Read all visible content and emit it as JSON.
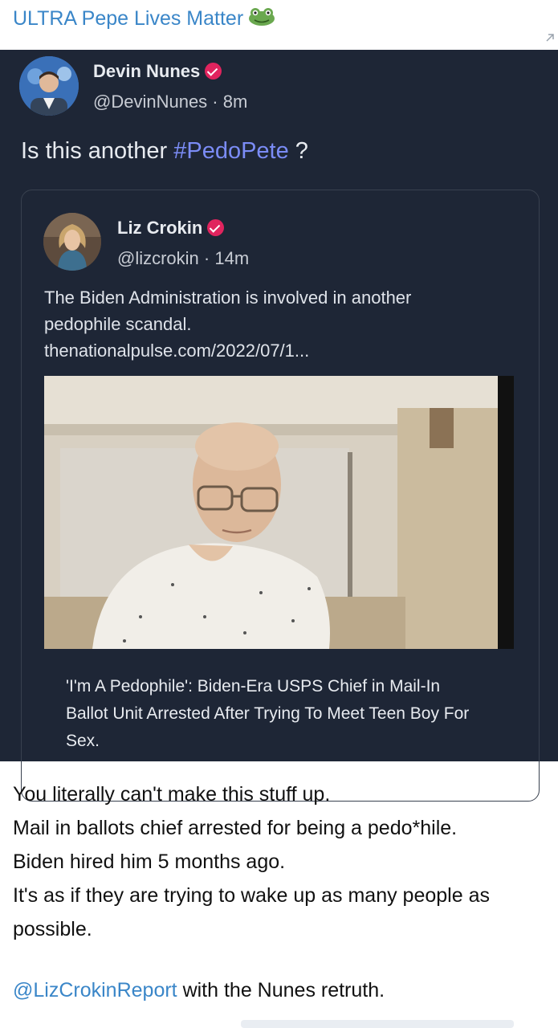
{
  "channel": {
    "title": "ULTRA Pepe Lives Matter"
  },
  "post": {
    "author_name": "Devin Nunes",
    "handle_time": "@DevinNunes · 8m",
    "text_before": "Is this another ",
    "hashtag": "#PedoPete",
    "text_after": " ?"
  },
  "quote": {
    "author_name": "Liz Crokin",
    "handle_time": "@lizcrokin · 14m",
    "text_lines": [
      "The Biden Administration is involved in another",
      "pedophile scandal.",
      "thenationalpulse.com/2022/07/1..."
    ],
    "link_title": "'I'm A Pedophile': Biden-Era USPS Chief in Mail-In Ballot Unit Arrested After Trying To Meet Teen Boy For Sex."
  },
  "caption": {
    "lines": [
      "You literally can't make this stuff up.",
      "Mail in ballots chief arrested for being a pedo*hile.",
      "Biden hired him 5 months ago.",
      "It's as if they are trying to wake up as many people as",
      "possible."
    ],
    "mention": "@LizCrokinReport",
    "mention_suffix": " with the Nunes retruth."
  },
  "icons": {
    "channel_emoji": "frog-icon",
    "verified": "verified-badge-icon"
  },
  "colors": {
    "card_bg": "#1e2636",
    "link_blue": "#3a86c8",
    "hashtag": "#7b8cf6",
    "verified": "#e0245e"
  }
}
